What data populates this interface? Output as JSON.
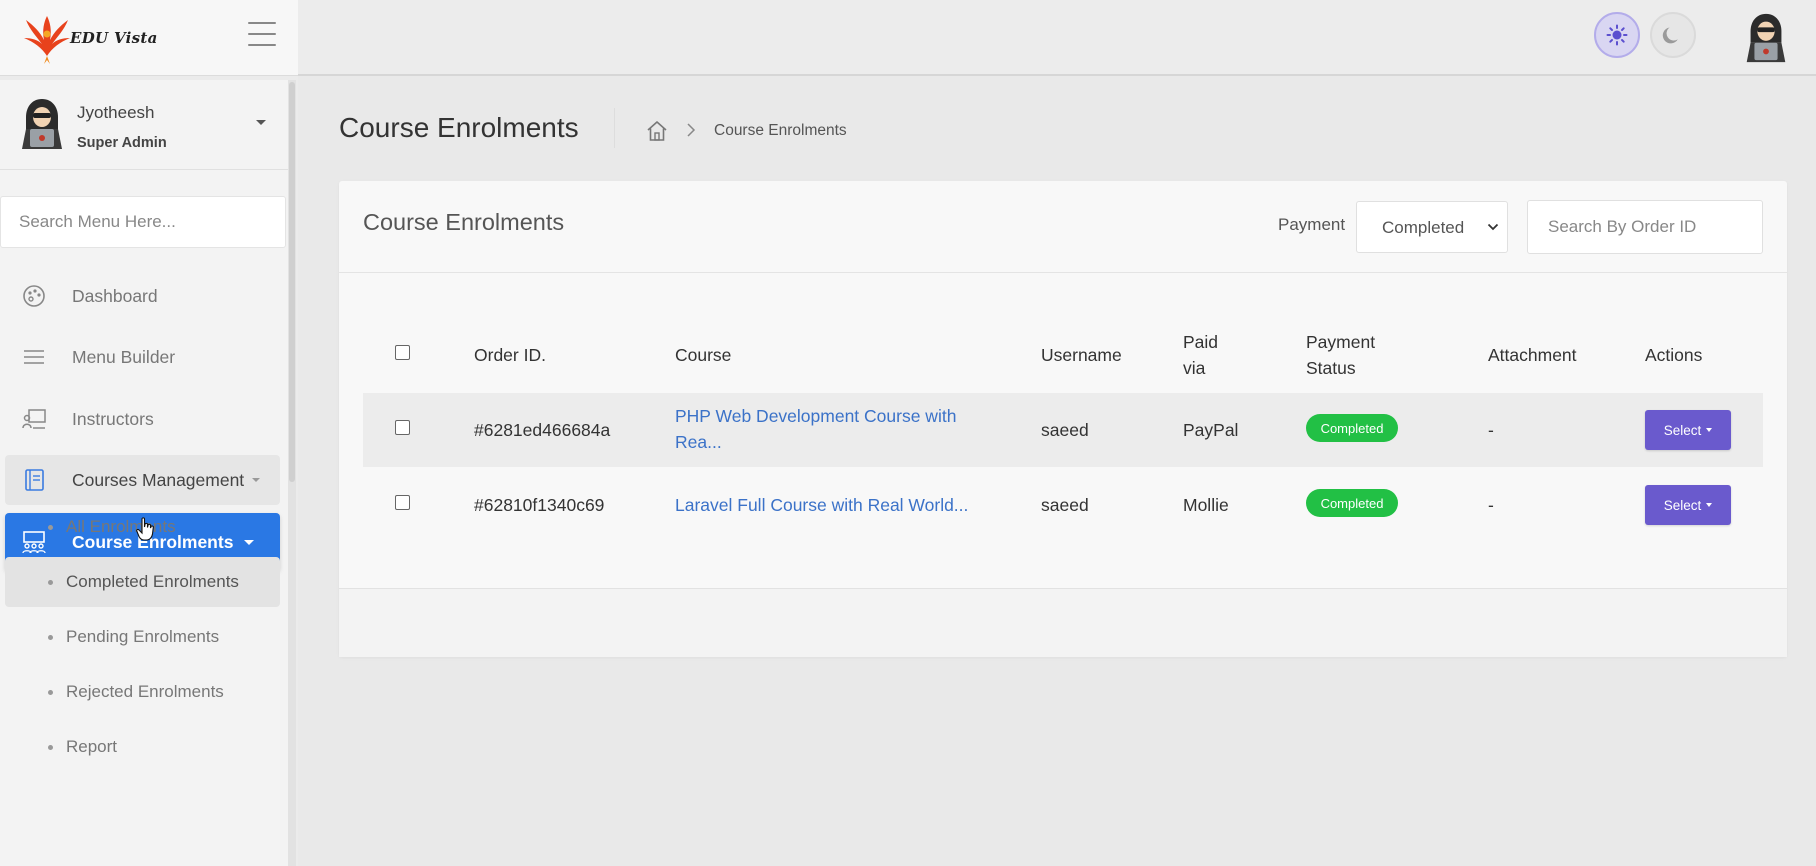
{
  "brand": {
    "name": "EDU Vista",
    "accent": "#2a78e4"
  },
  "profile": {
    "name": "Jyotheesh",
    "role": "Super Admin"
  },
  "sidebar": {
    "search_placeholder": "Search Menu Here...",
    "items": [
      {
        "label": "Dashboard",
        "icon": "dashboard-icon"
      },
      {
        "label": "Menu Builder",
        "icon": "menu-icon"
      },
      {
        "label": "Instructors",
        "icon": "instructor-icon"
      },
      {
        "label": "Courses Management",
        "icon": "book-icon"
      },
      {
        "label": "Course Enrolments",
        "icon": "enrolments-icon"
      }
    ],
    "subitems": [
      {
        "label": "All Enrolments"
      },
      {
        "label": "Completed Enrolments"
      },
      {
        "label": "Pending Enrolments"
      },
      {
        "label": "Rejected Enrolments"
      },
      {
        "label": "Report"
      }
    ]
  },
  "page": {
    "title": "Course Enrolments",
    "breadcrumb": {
      "current": "Course Enrolments"
    }
  },
  "card": {
    "title": "Course Enrolments",
    "filter_label": "Payment",
    "filter_value": "Completed",
    "search_placeholder": "Search By Order ID"
  },
  "table": {
    "headers": {
      "order_id": "Order ID.",
      "course": "Course",
      "username": "Username",
      "paid_via_1": "Paid",
      "paid_via_2": "via",
      "status_1": "Payment",
      "status_2": "Status",
      "attachment": "Attachment",
      "actions": "Actions"
    },
    "rows": [
      {
        "order_id": "#6281ed466684a",
        "course_1": "PHP Web Development Course with",
        "course_2": "Rea...",
        "username": "saeed",
        "paid_via": "PayPal",
        "status": "Completed",
        "attachment": "-",
        "action": "Select"
      },
      {
        "order_id": "#62810f1340c69",
        "course_1": "Laravel Full Course with Real World...",
        "username": "saeed",
        "paid_via": "Mollie",
        "status": "Completed",
        "attachment": "-",
        "action": "Select"
      }
    ]
  },
  "colors": {
    "status_completed": "#22c045",
    "action_button": "#6a5acd",
    "link": "#3b72c8"
  }
}
